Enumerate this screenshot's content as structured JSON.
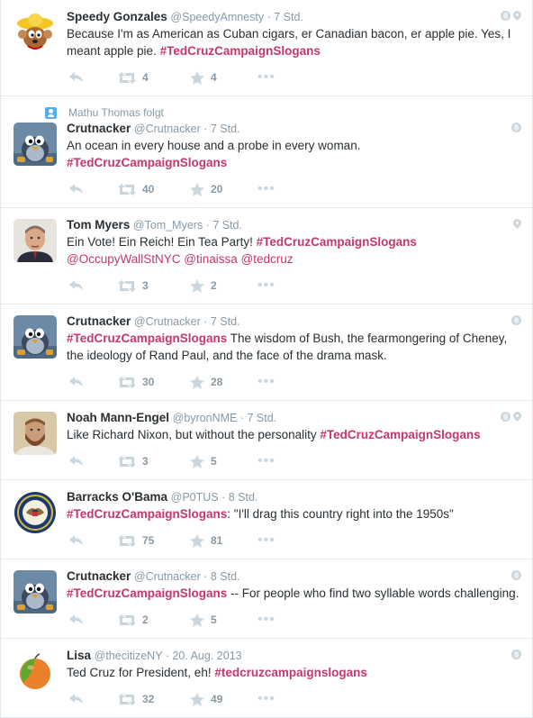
{
  "tweets": [
    {
      "name": "Speedy Gonzales",
      "handle": "@SpeedyAmnesty",
      "time": "7 Std.",
      "segments": [
        {
          "t": "text",
          "v": "Because I'm as American as Cuban cigars, er Canadian bacon, er apple pie. Yes, I meant apple pie.  "
        },
        {
          "t": "hashtag",
          "v": "#TedCruzCampaignSlogans"
        }
      ],
      "retweets": "4",
      "favorites": "4",
      "avatar": "speedy",
      "globe": true,
      "pin": true
    },
    {
      "context": "Mathu Thomas folgt",
      "name": "Crutnacker",
      "handle": "@Crutnacker",
      "time": "7 Std.",
      "segments": [
        {
          "t": "text",
          "v": "An ocean in every house and a probe in every woman."
        },
        {
          "t": "br"
        },
        {
          "t": "hashtag",
          "v": "#TedCruzCampaignSlogans"
        }
      ],
      "retweets": "40",
      "favorites": "20",
      "avatar": "bird",
      "globe": true,
      "pin": false
    },
    {
      "name": "Tom Myers",
      "handle": "@Tom_Myers",
      "time": "7 Std.",
      "segments": [
        {
          "t": "text",
          "v": "Ein Vote! Ein Reich! Ein Tea Party! "
        },
        {
          "t": "hashtag",
          "v": "#TedCruzCampaignSlogans"
        },
        {
          "t": "br"
        },
        {
          "t": "mention",
          "v": "@OccupyWallStNYC"
        },
        {
          "t": "text",
          "v": " "
        },
        {
          "t": "mention",
          "v": "@tinaissa"
        },
        {
          "t": "text",
          "v": " "
        },
        {
          "t": "mention",
          "v": "@tedcruz"
        }
      ],
      "retweets": "3",
      "favorites": "2",
      "avatar": "person",
      "globe": false,
      "pin": true
    },
    {
      "name": "Crutnacker",
      "handle": "@Crutnacker",
      "time": "7 Std.",
      "segments": [
        {
          "t": "hashtag",
          "v": "#TedCruzCampaignSlogans"
        },
        {
          "t": "text",
          "v": " The wisdom of Bush, the fearmongering of Cheney, the ideology of Rand Paul, and the face of the drama mask."
        }
      ],
      "retweets": "30",
      "favorites": "28",
      "avatar": "bird",
      "globe": true,
      "pin": false
    },
    {
      "name": "Noah Mann-Engel",
      "handle": "@byronNME",
      "time": "7 Std.",
      "segments": [
        {
          "t": "text",
          "v": "Like Richard Nixon, but without the personality "
        },
        {
          "t": "hashtag",
          "v": "#TedCruzCampaignSlogans"
        }
      ],
      "retweets": "3",
      "favorites": "5",
      "avatar": "beard",
      "globe": true,
      "pin": true
    },
    {
      "name": "Barracks O'Bama",
      "handle": "@P0TUS",
      "time": "8 Std.",
      "segments": [
        {
          "t": "hashtag",
          "v": "#TedCruzCampaignSlogans"
        },
        {
          "t": "text",
          "v": ": \"I'll drag this country right into the 1950s\""
        }
      ],
      "retweets": "75",
      "favorites": "81",
      "avatar": "seal",
      "globe": false,
      "pin": false
    },
    {
      "name": "Crutnacker",
      "handle": "@Crutnacker",
      "time": "8 Std.",
      "segments": [
        {
          "t": "hashtag",
          "v": "#TedCruzCampaignSlogans"
        },
        {
          "t": "text",
          "v": " -- For people who find two syllable words challenging."
        }
      ],
      "retweets": "2",
      "favorites": "5",
      "avatar": "bird",
      "globe": true,
      "pin": false
    },
    {
      "name": "Lisa",
      "handle": "@thecitizeNY",
      "time": "20. Aug. 2013",
      "segments": [
        {
          "t": "text",
          "v": "Ted Cruz for President, eh! "
        },
        {
          "t": "hashtag",
          "v": "#tedcruzcampaignslogans"
        }
      ],
      "retweets": "32",
      "favorites": "49",
      "avatar": "orange",
      "globe": true,
      "pin": false
    }
  ],
  "colors": {
    "hashtag": "#c4366f",
    "muted": "#8899a6",
    "icon": "#ccd6dd",
    "border": "#e1e8ed"
  },
  "icons": {
    "reply": "reply-arrow-icon",
    "retweet": "retweet-icon",
    "favorite": "star-icon",
    "more": "more-dots-icon",
    "globe": "globe-icon",
    "location": "location-pin-icon"
  },
  "more_label": "•••"
}
